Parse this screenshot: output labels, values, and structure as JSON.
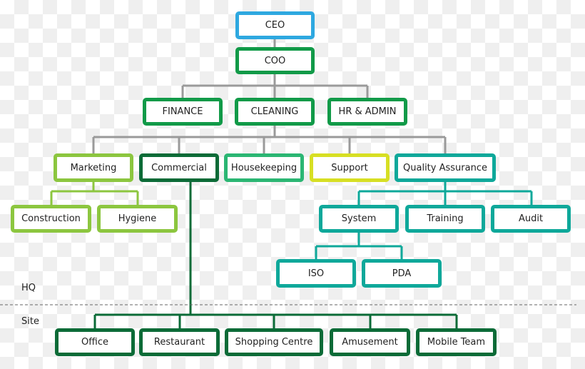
{
  "colors": {
    "ceo": "#2ea8e0",
    "green": "#119a48",
    "marketing": "#8cc63f",
    "commercial": "#0b6b37",
    "housekeeping": "#2bb673",
    "support": "#d7df23",
    "quality": "#0ea89a",
    "connector": "#9a9a9a"
  },
  "nodes": {
    "ceo": "CEO",
    "coo": "COO",
    "finance": "FINANCE",
    "cleaning": "CLEANING",
    "hr_admin": "HR & ADMIN",
    "marketing": "Marketing",
    "commercial": "Commercial",
    "housekeeping": "Housekeeping",
    "support": "Support",
    "quality_assurance": "Quality Assurance",
    "construction": "Construction",
    "hygiene": "Hygiene",
    "system": "System",
    "training": "Training",
    "audit": "Audit",
    "iso": "ISO",
    "pda": "PDA",
    "office": "Office",
    "restaurant": "Restaurant",
    "shopping_centre": "Shopping Centre",
    "amusement": "Amusement",
    "mobile_team": "Mobile Team"
  },
  "zones": {
    "hq": "HQ",
    "site": "Site"
  }
}
